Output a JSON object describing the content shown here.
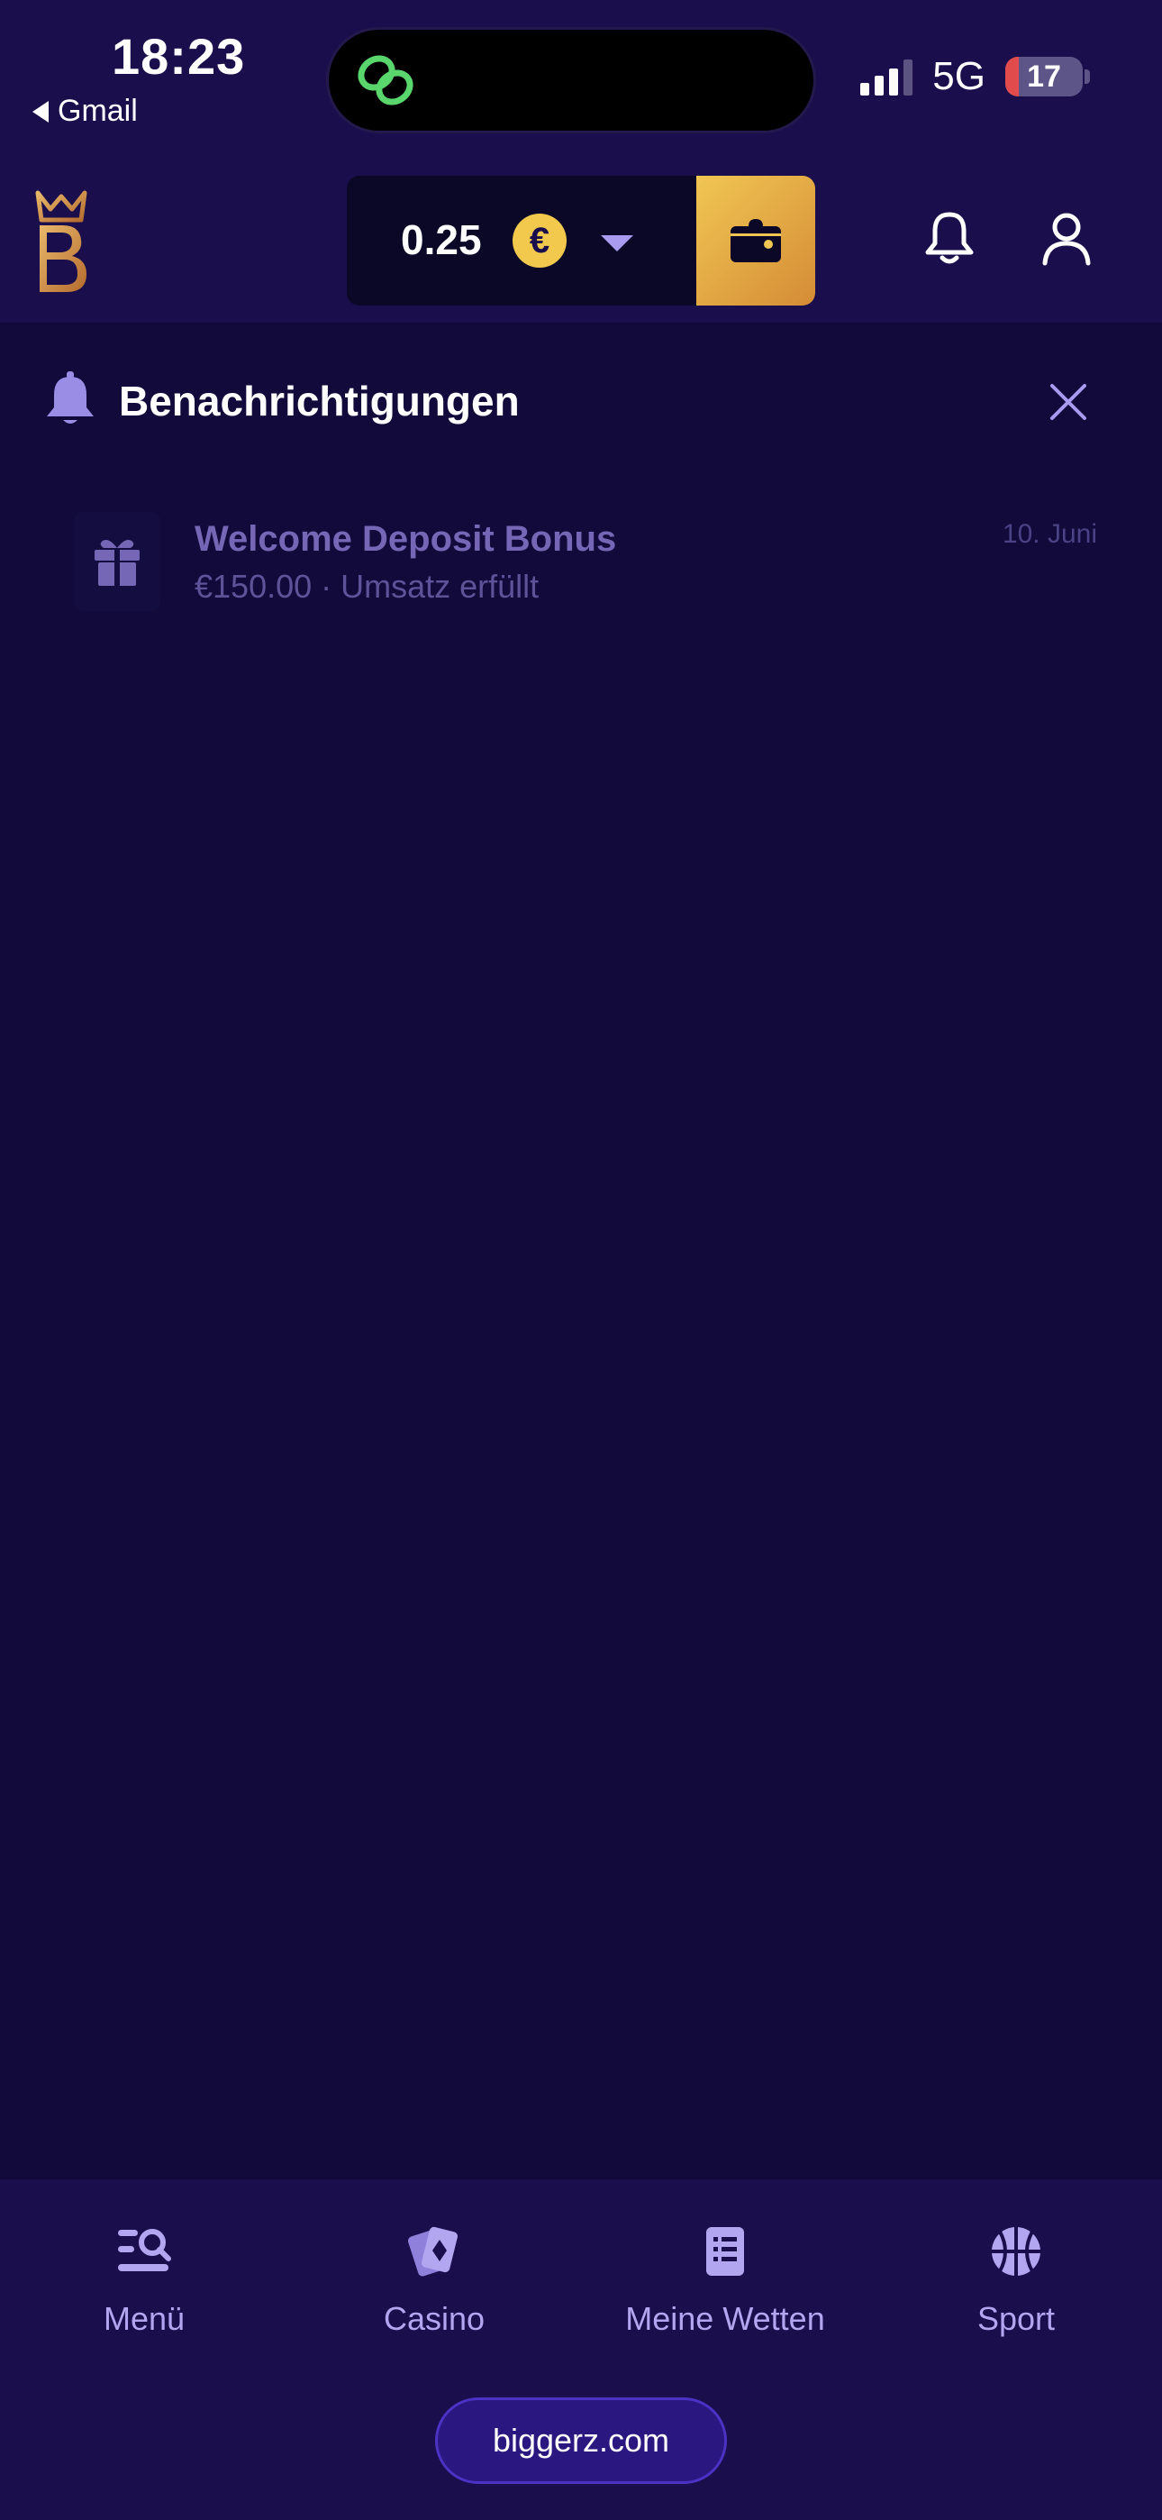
{
  "status_bar": {
    "time": "18:23",
    "back_app": "Gmail",
    "network": "5G",
    "battery": "17"
  },
  "header": {
    "balance": "0.25",
    "currency_symbol": "€",
    "brand_color": "#1a0e4c",
    "accent_color": "#f0c653"
  },
  "notifications": {
    "title": "Benachrichtigungen",
    "items": [
      {
        "title": "Welcome Deposit Bonus",
        "subtitle": "€150.00 · Umsatz erfüllt",
        "date": "10. Juni",
        "icon": "gift-icon"
      }
    ]
  },
  "bottom_nav": {
    "items": [
      {
        "label": "Menü",
        "icon": "menu-search-icon"
      },
      {
        "label": "Casino",
        "icon": "cards-icon"
      },
      {
        "label": "Meine Wetten",
        "icon": "bet-slip-icon"
      },
      {
        "label": "Sport",
        "icon": "basketball-icon"
      }
    ],
    "url": "biggerz.com"
  }
}
